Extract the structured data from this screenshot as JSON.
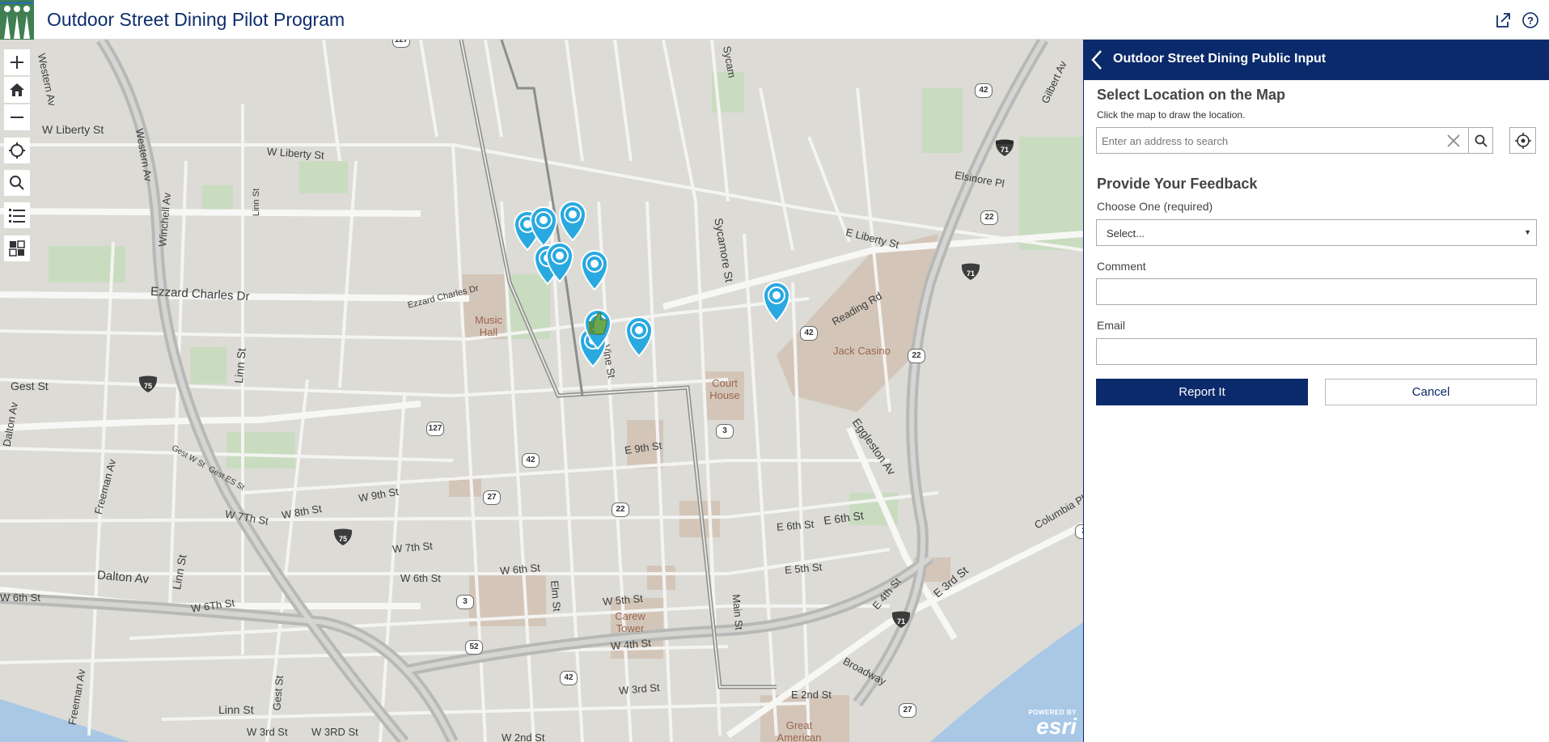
{
  "header": {
    "title": "Outdoor Street Dining Pilot Program",
    "share_icon": "share-icon",
    "help_icon": "help-icon"
  },
  "map": {
    "controls": [
      "zoom-in-icon",
      "home-icon",
      "zoom-out-icon",
      "locate-icon",
      "search-icon",
      "list-icon",
      "basemap-icon"
    ],
    "streets": {
      "w_liberty_st_1": "W Liberty St",
      "w_liberty_st_2": "W Liberty St",
      "western_av_1": "Western Av",
      "western_av_2": "Western Av",
      "winchell_av": "Winchell Av",
      "linn_st_top": "Linn St",
      "ezzard_charles_dr": "Ezzard Charles Dr",
      "ezzard_charles_dr_small": "Ezzard Charles Dr",
      "gest_st": "Gest St",
      "linn_st_mid": "Linn St",
      "dalton_av_left": "Dalton Av",
      "freeman_av_1": "Freeman Av",
      "gest_w_st": "Gest W St",
      "gest_es_st": "Gest ES St",
      "w_9th_st": "W 9th St",
      "w_8th_st": "W 8th St",
      "w_7th_st_1": "W 7Th St",
      "w_7th_st_2": "W 7th St",
      "linn_st_low": "Linn St",
      "dalton_av": "Dalton Av",
      "w_6th_st_1": "W 6th St",
      "w_6th_st_2": "W 6Th St",
      "w_6th_st_3": "W 6th St",
      "w_6th_st_4": "W 6th St",
      "elm_st": "Elm St",
      "w_5th_st": "W 5th St",
      "w_4th_st": "W 4th St",
      "w_3rd_st": "W 3rd St",
      "w_3rd_st_2": "W 3rd St",
      "w_3rd_st_3": "W 3RD St",
      "w_2nd_st": "W 2nd St",
      "freeman_av_2": "Freeman Av",
      "gest_st_2": "Gest St",
      "linn_st_bottom": "Linn St",
      "e_9th_st": "E 9th St",
      "main_st": "Main St",
      "e_6th_st_1": "E 6th St",
      "e_6th_st_2": "E 6th St",
      "e_5th_st": "E 5th St",
      "e_4th_st": "E 4th St",
      "e_3rd_st": "E 3rd St",
      "e_2nd_st": "E 2nd St",
      "broadway": "Broadway",
      "eggleston_av": "Eggleston Av",
      "reading_rd": "Reading Rd",
      "e_liberty_st": "E Liberty St",
      "elsinore_pl": "Elsinore Pl",
      "gilbert_av": "Gilbert Av",
      "sycamore_st": "Sycamore St",
      "sycamore_st_top": "Sycam",
      "vine_st": "Vine St",
      "columbia_pkwy": "Columbia Pk"
    },
    "pois": {
      "music_hall": "Music Hall",
      "court_house": "Court House",
      "jack_casino": "Jack Casino",
      "carew_tower": "Carew Tower",
      "great_american": "Great American"
    },
    "shields": {
      "us127_top": "127",
      "us127_mid": "127",
      "us42_top": "42",
      "us42_mid": "42",
      "us42_a": "42",
      "us42_b": "42",
      "us22_a": "22",
      "us22_b": "22",
      "us22_c": "22",
      "us27_a": "27",
      "us27_b": "27",
      "us52": "52",
      "sr3_a": "3",
      "sr3_b": "3",
      "sr3_c": "3",
      "i71_a": "71",
      "i71_b": "71",
      "i71_c": "71",
      "i75_a": "75",
      "i75_b": "75"
    },
    "attribution": {
      "powered_by": "POWERED BY",
      "brand": "esri"
    }
  },
  "panel": {
    "title": "Outdoor Street Dining Public Input",
    "back_icon": "chevron-left-icon",
    "location": {
      "heading": "Select Location on the Map",
      "hint": "Click the map to draw the location.",
      "search_placeholder": "Enter an address to search"
    },
    "feedback": {
      "heading": "Provide Your Feedback",
      "choose_label": "Choose One (required)",
      "choose_value": "Select...",
      "comment_label": "Comment",
      "comment_value": "",
      "email_label": "Email",
      "email_value": ""
    },
    "buttons": {
      "submit": "Report It",
      "cancel": "Cancel"
    }
  },
  "colors": {
    "brand_navy": "#0b2a6b",
    "pin_blue": "#29a9e0",
    "logo_green": "#3f7f52"
  }
}
